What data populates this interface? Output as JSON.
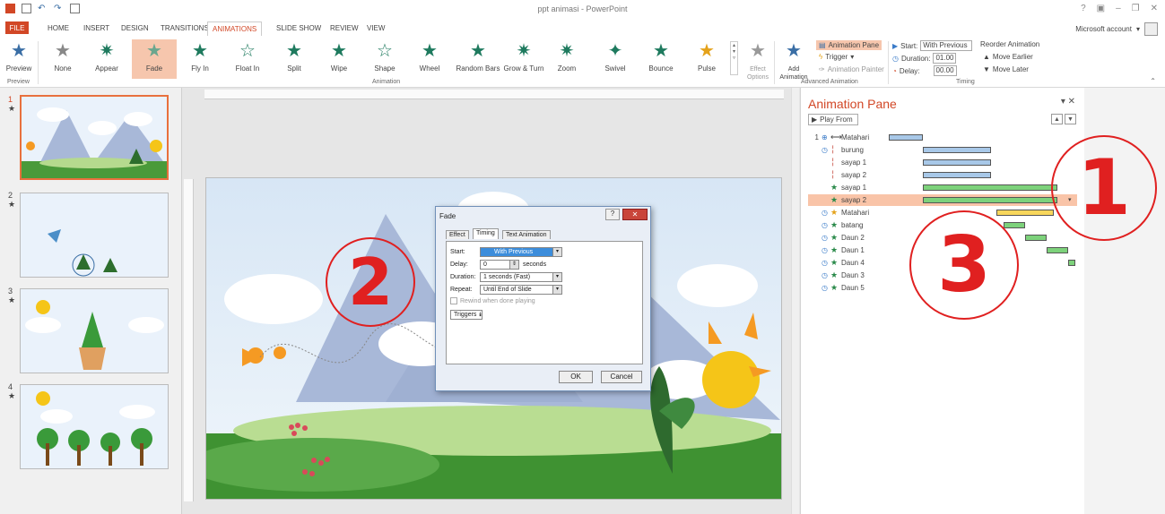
{
  "window": {
    "title": "ppt animasi - PowerPoint",
    "account": "Microsoft account"
  },
  "tabs": [
    "FILE",
    "HOME",
    "INSERT",
    "DESIGN",
    "TRANSITIONS",
    "ANIMATIONS",
    "SLIDE SHOW",
    "REVIEW",
    "VIEW"
  ],
  "ribbon": {
    "preview": "Preview",
    "preview_group": "Preview",
    "animations": [
      "None",
      "Appear",
      "Fade",
      "Fly In",
      "Float In",
      "Split",
      "Wipe",
      "Shape",
      "Wheel",
      "Random Bars",
      "Grow & Turn",
      "Zoom",
      "Swivel",
      "Bounce",
      "Pulse"
    ],
    "animation_group": "Animation",
    "effect_options": "Effect Options",
    "add_animation": "Add Animation",
    "animation_pane": "Animation Pane",
    "trigger": "Trigger",
    "animation_painter": "Animation Painter",
    "advanced_group": "Advanced Animation",
    "start_label": "Start:",
    "start_value": "With Previous",
    "duration_label": "Duration:",
    "duration_value": "01.00",
    "delay_label": "Delay:",
    "delay_value": "00.00",
    "reorder": "Reorder Animation",
    "move_earlier": "Move Earlier",
    "move_later": "Move Later",
    "timing_group": "Timing"
  },
  "slides": [
    "1",
    "2",
    "3",
    "4"
  ],
  "pane": {
    "title": "Animation Pane",
    "play_from": "Play From",
    "items": [
      {
        "num": "1",
        "name": "Matahari"
      },
      {
        "num": "",
        "name": "burung"
      },
      {
        "num": "",
        "name": "sayap 1"
      },
      {
        "num": "",
        "name": "sayap 2"
      },
      {
        "num": "",
        "name": "sayap 1"
      },
      {
        "num": "",
        "name": "sayap 2"
      },
      {
        "num": "",
        "name": "Matahari"
      },
      {
        "num": "",
        "name": "batang"
      },
      {
        "num": "",
        "name": "Daun 2"
      },
      {
        "num": "",
        "name": "Daun 1"
      },
      {
        "num": "",
        "name": "Daun 4"
      },
      {
        "num": "",
        "name": "Daun 3"
      },
      {
        "num": "",
        "name": "Daun 5"
      }
    ]
  },
  "dialog": {
    "title": "Fade",
    "tabs": [
      "Effect",
      "Timing",
      "Text Animation"
    ],
    "start_label": "Start:",
    "start_value": "With Previous",
    "delay_label": "Delay:",
    "delay_value": "0",
    "delay_unit": "seconds",
    "duration_label": "Duration:",
    "duration_value": "1 seconds (Fast)",
    "repeat_label": "Repeat:",
    "repeat_value": "Until End of Slide",
    "rewind": "Rewind when done playing",
    "triggers": "Triggers",
    "ok": "OK",
    "cancel": "Cancel"
  },
  "annotations": {
    "one": "1",
    "two": "2",
    "three": "3"
  },
  "colors": {
    "accent": "#d24726",
    "annotation": "#e02020"
  }
}
